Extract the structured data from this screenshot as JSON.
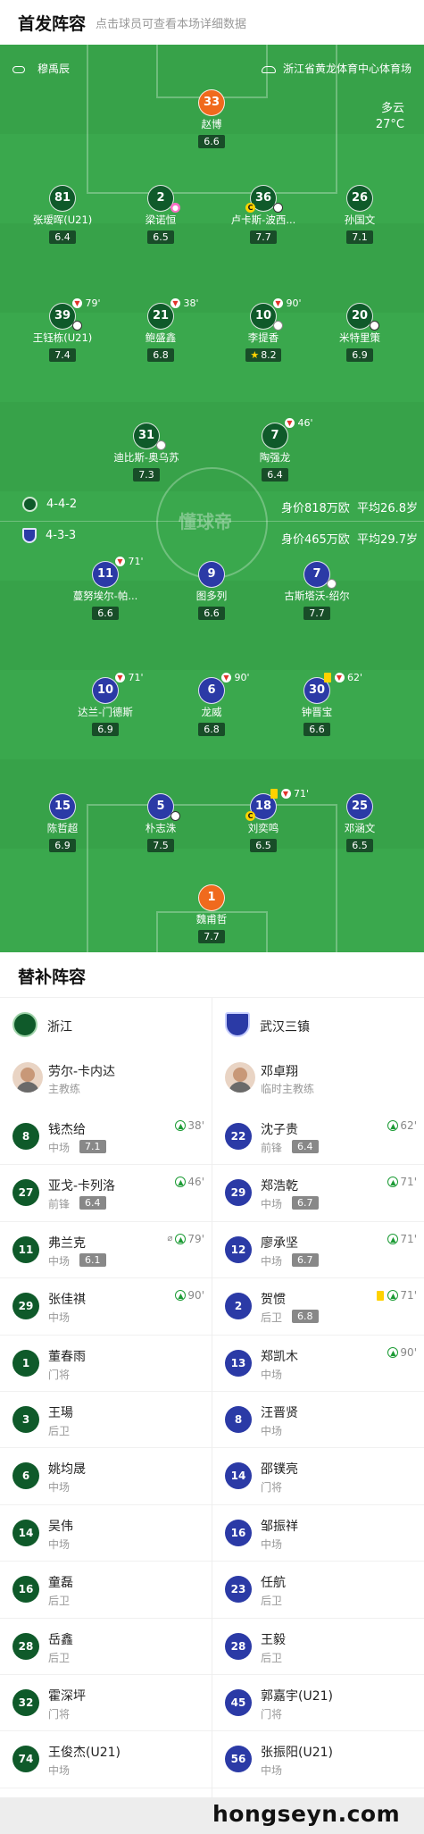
{
  "header": {
    "title": "首发阵容",
    "subtitle": "点击球员可查看本场详细数据"
  },
  "match": {
    "referee": "穆禹辰",
    "venue": "浙江省黄龙体育中心体育场",
    "weather": "多云",
    "temperature": "27°C",
    "watermark": "懂球帝"
  },
  "home": {
    "formation": "4-4-2",
    "value": "身价818万欧",
    "age": "平均26.8岁",
    "players": [
      {
        "no": "33",
        "name": "赵博",
        "rating": "6.6",
        "gk": true
      },
      {
        "no": "81",
        "name": "张瑷晖(U21)",
        "rating": "6.4"
      },
      {
        "no": "2",
        "name": "梁诺恒",
        "rating": "6.5"
      },
      {
        "no": "36",
        "name": "卢卡斯-波西...",
        "rating": "7.7",
        "captain": true
      },
      {
        "no": "26",
        "name": "孙国文",
        "rating": "7.1"
      },
      {
        "no": "39",
        "name": "王钰栋(U21)",
        "rating": "7.4",
        "minute": "79'"
      },
      {
        "no": "21",
        "name": "鲍盛鑫",
        "rating": "6.8",
        "minute": "38'"
      },
      {
        "no": "10",
        "name": "李提香",
        "rating": "8.2",
        "minute": "90'",
        "star": true
      },
      {
        "no": "20",
        "name": "米特里策",
        "rating": "6.9"
      },
      {
        "no": "31",
        "name": "迪比斯-奥乌苏",
        "rating": "7.3"
      },
      {
        "no": "7",
        "name": "陶强龙",
        "rating": "6.4",
        "minute": "46'"
      }
    ]
  },
  "away": {
    "formation": "4-3-3",
    "value": "身价465万欧",
    "age": "平均29.7岁",
    "players": [
      {
        "no": "11",
        "name": "蔓努埃尔-帕...",
        "rating": "6.6",
        "minute": "71'"
      },
      {
        "no": "9",
        "name": "图多列",
        "rating": "6.6"
      },
      {
        "no": "7",
        "name": "古斯塔沃-绍尔",
        "rating": "7.7"
      },
      {
        "no": "10",
        "name": "达兰-门德斯",
        "rating": "6.9",
        "minute": "71'"
      },
      {
        "no": "6",
        "name": "龙威",
        "rating": "6.8",
        "minute": "90'"
      },
      {
        "no": "30",
        "name": "钟晋宝",
        "rating": "6.6",
        "minute": "62'"
      },
      {
        "no": "15",
        "name": "陈哲超",
        "rating": "6.9"
      },
      {
        "no": "5",
        "name": "朴志洙",
        "rating": "7.5"
      },
      {
        "no": "18",
        "name": "刘奕鸣",
        "rating": "6.5",
        "minute": "71'",
        "captain": true
      },
      {
        "no": "25",
        "name": "邓涵文",
        "rating": "6.5"
      },
      {
        "no": "1",
        "name": "魏甫哲",
        "rating": "7.7",
        "gk": true
      }
    ]
  },
  "subs": {
    "title": "替补阵容",
    "home": {
      "team": "浙江",
      "coach": "劳尔-卡内达",
      "coach_role": "主教练",
      "players": [
        {
          "no": "8",
          "name": "钱杰给",
          "pos": "中场",
          "rating": "7.1",
          "minute": "38'"
        },
        {
          "no": "27",
          "name": "亚戈-卡列洛",
          "pos": "前锋",
          "rating": "6.4",
          "minute": "46'"
        },
        {
          "no": "11",
          "name": "弗兰克",
          "pos": "中场",
          "rating": "6.1",
          "minute": "79'"
        },
        {
          "no": "29",
          "name": "张佳祺",
          "pos": "中场",
          "rating": "",
          "minute": "90'"
        },
        {
          "no": "1",
          "name": "董春雨",
          "pos": "门将",
          "rating": "",
          "minute": ""
        },
        {
          "no": "3",
          "name": "王瑒",
          "pos": "后卫",
          "rating": "",
          "minute": ""
        },
        {
          "no": "6",
          "name": "姚均晟",
          "pos": "中场",
          "rating": "",
          "minute": ""
        },
        {
          "no": "14",
          "name": "吴伟",
          "pos": "中场",
          "rating": "",
          "minute": ""
        },
        {
          "no": "16",
          "name": "童磊",
          "pos": "后卫",
          "rating": "",
          "minute": ""
        },
        {
          "no": "28",
          "name": "岳鑫",
          "pos": "后卫",
          "rating": "",
          "minute": ""
        },
        {
          "no": "32",
          "name": "霍深坪",
          "pos": "门将",
          "rating": "",
          "minute": ""
        },
        {
          "no": "74",
          "name": "王俊杰(U21)",
          "pos": "中场",
          "rating": "",
          "minute": ""
        }
      ]
    },
    "away": {
      "team": "武汉三镇",
      "coach": "邓卓翔",
      "coach_role": "临时主教练",
      "players": [
        {
          "no": "22",
          "name": "沈子贵",
          "pos": "前锋",
          "rating": "6.4",
          "minute": "62'"
        },
        {
          "no": "29",
          "name": "郑浩乾",
          "pos": "中场",
          "rating": "6.7",
          "minute": "71'"
        },
        {
          "no": "12",
          "name": "廖承坚",
          "pos": "中场",
          "rating": "6.7",
          "minute": "71'"
        },
        {
          "no": "2",
          "name": "贺惯",
          "pos": "后卫",
          "rating": "6.8",
          "minute": "71'"
        },
        {
          "no": "13",
          "name": "郑凯木",
          "pos": "中场",
          "rating": "",
          "minute": "90'"
        },
        {
          "no": "8",
          "name": "汪晋贤",
          "pos": "中场",
          "rating": "",
          "minute": ""
        },
        {
          "no": "14",
          "name": "邵镤亮",
          "pos": "门将",
          "rating": "",
          "minute": ""
        },
        {
          "no": "16",
          "name": "邹振祥",
          "pos": "中场",
          "rating": "",
          "minute": ""
        },
        {
          "no": "23",
          "name": "任航",
          "pos": "后卫",
          "rating": "",
          "minute": ""
        },
        {
          "no": "28",
          "name": "王毅",
          "pos": "后卫",
          "rating": "",
          "minute": ""
        },
        {
          "no": "45",
          "name": "郭嘉宇(U21)",
          "pos": "门将",
          "rating": "",
          "minute": ""
        },
        {
          "no": "56",
          "name": "张振阳(U21)",
          "pos": "中场",
          "rating": "",
          "minute": ""
        }
      ]
    }
  },
  "footer": {
    "watermark": "hongseyn.com"
  }
}
